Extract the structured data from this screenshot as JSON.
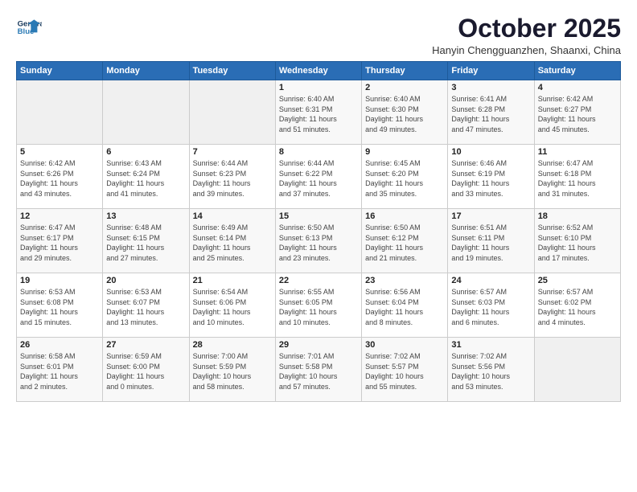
{
  "header": {
    "title": "October 2025",
    "subtitle": "Hanyin Chengguanzhen, Shaanxi, China"
  },
  "days": [
    "Sunday",
    "Monday",
    "Tuesday",
    "Wednesday",
    "Thursday",
    "Friday",
    "Saturday"
  ],
  "weeks": [
    [
      {
        "num": "",
        "info": ""
      },
      {
        "num": "",
        "info": ""
      },
      {
        "num": "",
        "info": ""
      },
      {
        "num": "1",
        "info": "Sunrise: 6:40 AM\nSunset: 6:31 PM\nDaylight: 11 hours\nand 51 minutes."
      },
      {
        "num": "2",
        "info": "Sunrise: 6:40 AM\nSunset: 6:30 PM\nDaylight: 11 hours\nand 49 minutes."
      },
      {
        "num": "3",
        "info": "Sunrise: 6:41 AM\nSunset: 6:28 PM\nDaylight: 11 hours\nand 47 minutes."
      },
      {
        "num": "4",
        "info": "Sunrise: 6:42 AM\nSunset: 6:27 PM\nDaylight: 11 hours\nand 45 minutes."
      }
    ],
    [
      {
        "num": "5",
        "info": "Sunrise: 6:42 AM\nSunset: 6:26 PM\nDaylight: 11 hours\nand 43 minutes."
      },
      {
        "num": "6",
        "info": "Sunrise: 6:43 AM\nSunset: 6:24 PM\nDaylight: 11 hours\nand 41 minutes."
      },
      {
        "num": "7",
        "info": "Sunrise: 6:44 AM\nSunset: 6:23 PM\nDaylight: 11 hours\nand 39 minutes."
      },
      {
        "num": "8",
        "info": "Sunrise: 6:44 AM\nSunset: 6:22 PM\nDaylight: 11 hours\nand 37 minutes."
      },
      {
        "num": "9",
        "info": "Sunrise: 6:45 AM\nSunset: 6:20 PM\nDaylight: 11 hours\nand 35 minutes."
      },
      {
        "num": "10",
        "info": "Sunrise: 6:46 AM\nSunset: 6:19 PM\nDaylight: 11 hours\nand 33 minutes."
      },
      {
        "num": "11",
        "info": "Sunrise: 6:47 AM\nSunset: 6:18 PM\nDaylight: 11 hours\nand 31 minutes."
      }
    ],
    [
      {
        "num": "12",
        "info": "Sunrise: 6:47 AM\nSunset: 6:17 PM\nDaylight: 11 hours\nand 29 minutes."
      },
      {
        "num": "13",
        "info": "Sunrise: 6:48 AM\nSunset: 6:15 PM\nDaylight: 11 hours\nand 27 minutes."
      },
      {
        "num": "14",
        "info": "Sunrise: 6:49 AM\nSunset: 6:14 PM\nDaylight: 11 hours\nand 25 minutes."
      },
      {
        "num": "15",
        "info": "Sunrise: 6:50 AM\nSunset: 6:13 PM\nDaylight: 11 hours\nand 23 minutes."
      },
      {
        "num": "16",
        "info": "Sunrise: 6:50 AM\nSunset: 6:12 PM\nDaylight: 11 hours\nand 21 minutes."
      },
      {
        "num": "17",
        "info": "Sunrise: 6:51 AM\nSunset: 6:11 PM\nDaylight: 11 hours\nand 19 minutes."
      },
      {
        "num": "18",
        "info": "Sunrise: 6:52 AM\nSunset: 6:10 PM\nDaylight: 11 hours\nand 17 minutes."
      }
    ],
    [
      {
        "num": "19",
        "info": "Sunrise: 6:53 AM\nSunset: 6:08 PM\nDaylight: 11 hours\nand 15 minutes."
      },
      {
        "num": "20",
        "info": "Sunrise: 6:53 AM\nSunset: 6:07 PM\nDaylight: 11 hours\nand 13 minutes."
      },
      {
        "num": "21",
        "info": "Sunrise: 6:54 AM\nSunset: 6:06 PM\nDaylight: 11 hours\nand 10 minutes."
      },
      {
        "num": "22",
        "info": "Sunrise: 6:55 AM\nSunset: 6:05 PM\nDaylight: 11 hours\nand 10 minutes."
      },
      {
        "num": "23",
        "info": "Sunrise: 6:56 AM\nSunset: 6:04 PM\nDaylight: 11 hours\nand 8 minutes."
      },
      {
        "num": "24",
        "info": "Sunrise: 6:57 AM\nSunset: 6:03 PM\nDaylight: 11 hours\nand 6 minutes."
      },
      {
        "num": "25",
        "info": "Sunrise: 6:57 AM\nSunset: 6:02 PM\nDaylight: 11 hours\nand 4 minutes."
      }
    ],
    [
      {
        "num": "26",
        "info": "Sunrise: 6:58 AM\nSunset: 6:01 PM\nDaylight: 11 hours\nand 2 minutes."
      },
      {
        "num": "27",
        "info": "Sunrise: 6:59 AM\nSunset: 6:00 PM\nDaylight: 11 hours\nand 0 minutes."
      },
      {
        "num": "28",
        "info": "Sunrise: 7:00 AM\nSunset: 5:59 PM\nDaylight: 10 hours\nand 58 minutes."
      },
      {
        "num": "29",
        "info": "Sunrise: 7:01 AM\nSunset: 5:58 PM\nDaylight: 10 hours\nand 57 minutes."
      },
      {
        "num": "30",
        "info": "Sunrise: 7:02 AM\nSunset: 5:57 PM\nDaylight: 10 hours\nand 55 minutes."
      },
      {
        "num": "31",
        "info": "Sunrise: 7:02 AM\nSunset: 5:56 PM\nDaylight: 10 hours\nand 53 minutes."
      },
      {
        "num": "",
        "info": ""
      }
    ]
  ]
}
